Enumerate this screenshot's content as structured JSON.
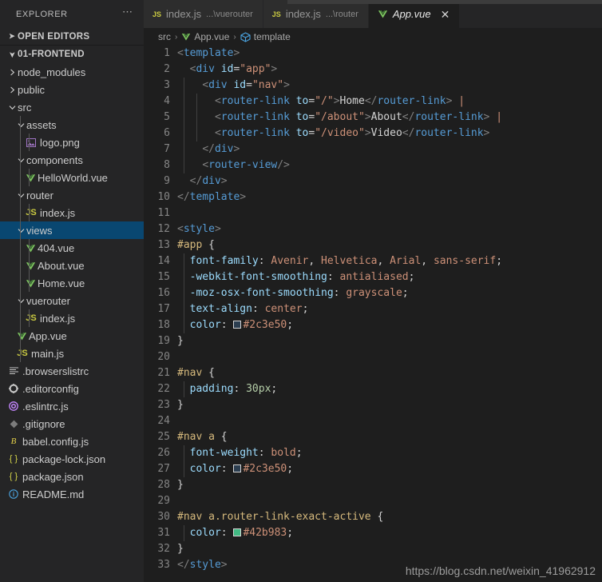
{
  "sidebar": {
    "title": "EXPLORER",
    "more_icon": "ellipsis-icon",
    "open_editors_label": "OPEN EDITORS",
    "project_label": "01-FRONTEND",
    "items": [
      {
        "label": "node_modules",
        "depth": 1,
        "kind": "folder",
        "expanded": false,
        "icon": "chevron-right-icon"
      },
      {
        "label": "public",
        "depth": 1,
        "kind": "folder",
        "expanded": false,
        "icon": "chevron-right-icon"
      },
      {
        "label": "src",
        "depth": 1,
        "kind": "folder",
        "expanded": true,
        "icon": "chevron-down-icon"
      },
      {
        "label": "assets",
        "depth": 2,
        "kind": "folder",
        "expanded": true,
        "icon": "chevron-down-icon"
      },
      {
        "label": "logo.png",
        "depth": 3,
        "kind": "file",
        "icon": "image-icon"
      },
      {
        "label": "components",
        "depth": 2,
        "kind": "folder",
        "expanded": true,
        "icon": "chevron-down-icon"
      },
      {
        "label": "HelloWorld.vue",
        "depth": 3,
        "kind": "file",
        "icon": "vue-icon"
      },
      {
        "label": "router",
        "depth": 2,
        "kind": "folder",
        "expanded": true,
        "icon": "chevron-down-icon"
      },
      {
        "label": "index.js",
        "depth": 3,
        "kind": "file",
        "icon": "js-icon"
      },
      {
        "label": "views",
        "depth": 2,
        "kind": "folder",
        "expanded": true,
        "icon": "chevron-down-icon",
        "selected": true
      },
      {
        "label": "404.vue",
        "depth": 3,
        "kind": "file",
        "icon": "vue-icon"
      },
      {
        "label": "About.vue",
        "depth": 3,
        "kind": "file",
        "icon": "vue-icon"
      },
      {
        "label": "Home.vue",
        "depth": 3,
        "kind": "file",
        "icon": "vue-icon"
      },
      {
        "label": "vuerouter",
        "depth": 2,
        "kind": "folder",
        "expanded": true,
        "icon": "chevron-down-icon"
      },
      {
        "label": "index.js",
        "depth": 3,
        "kind": "file",
        "icon": "js-icon"
      },
      {
        "label": "App.vue",
        "depth": 2,
        "kind": "file",
        "icon": "vue-icon"
      },
      {
        "label": "main.js",
        "depth": 2,
        "kind": "file",
        "icon": "js-icon"
      },
      {
        "label": ".browserslistrc",
        "depth": 1,
        "kind": "file",
        "icon": "list-icon"
      },
      {
        "label": ".editorconfig",
        "depth": 1,
        "kind": "file",
        "icon": "gear-icon"
      },
      {
        "label": ".eslintrc.js",
        "depth": 1,
        "kind": "file",
        "icon": "eslint-icon"
      },
      {
        "label": ".gitignore",
        "depth": 1,
        "kind": "file",
        "icon": "git-icon"
      },
      {
        "label": "babel.config.js",
        "depth": 1,
        "kind": "file",
        "icon": "babel-icon"
      },
      {
        "label": "package-lock.json",
        "depth": 1,
        "kind": "file",
        "icon": "json-icon"
      },
      {
        "label": "package.json",
        "depth": 1,
        "kind": "file",
        "icon": "json-icon"
      },
      {
        "label": "README.md",
        "depth": 1,
        "kind": "file",
        "icon": "markdown-icon"
      }
    ]
  },
  "tabs": [
    {
      "label": "index.js",
      "desc": "...\\vuerouter",
      "icon": "js-icon",
      "active": false,
      "closable": false
    },
    {
      "label": "index.js",
      "desc": "...\\router",
      "icon": "js-icon",
      "active": false,
      "closable": false
    },
    {
      "label": "App.vue",
      "desc": "",
      "icon": "vue-icon",
      "active": true,
      "closable": true,
      "close_icon": "close-icon"
    }
  ],
  "breadcrumb": {
    "items": [
      {
        "label": "src",
        "icon": ""
      },
      {
        "label": "App.vue",
        "icon": "vue-icon"
      },
      {
        "label": "template",
        "icon": "symbol-cube-icon"
      }
    ],
    "separator": "›"
  },
  "editor": {
    "file": "App.vue",
    "language": "vue",
    "total_lines": 33,
    "lines": [
      {
        "n": 1,
        "indent": 0,
        "tokens": [
          {
            "t": "brk",
            "v": "<"
          },
          {
            "t": "tag",
            "v": "template"
          },
          {
            "t": "brk",
            "v": ">"
          }
        ]
      },
      {
        "n": 2,
        "indent": 0,
        "tokens": [
          {
            "t": "txt",
            "v": "  "
          },
          {
            "t": "brk",
            "v": "<"
          },
          {
            "t": "tag",
            "v": "div"
          },
          {
            "t": "txt",
            "v": " "
          },
          {
            "t": "attr",
            "v": "id"
          },
          {
            "t": "punc",
            "v": "="
          },
          {
            "t": "str",
            "v": "\"app\""
          },
          {
            "t": "brk",
            "v": ">"
          }
        ]
      },
      {
        "n": 3,
        "indent": 1,
        "tokens": [
          {
            "t": "txt",
            "v": "    "
          },
          {
            "t": "brk",
            "v": "<"
          },
          {
            "t": "tag",
            "v": "div"
          },
          {
            "t": "txt",
            "v": " "
          },
          {
            "t": "attr",
            "v": "id"
          },
          {
            "t": "punc",
            "v": "="
          },
          {
            "t": "str",
            "v": "\"nav\""
          },
          {
            "t": "brk",
            "v": ">"
          }
        ]
      },
      {
        "n": 4,
        "indent": 2,
        "tokens": [
          {
            "t": "txt",
            "v": "      "
          },
          {
            "t": "brk",
            "v": "<"
          },
          {
            "t": "tag",
            "v": "router-link"
          },
          {
            "t": "txt",
            "v": " "
          },
          {
            "t": "attr",
            "v": "to"
          },
          {
            "t": "punc",
            "v": "="
          },
          {
            "t": "str",
            "v": "\"/\""
          },
          {
            "t": "brk",
            "v": ">"
          },
          {
            "t": "txt",
            "v": "Home"
          },
          {
            "t": "brk",
            "v": "</"
          },
          {
            "t": "tag",
            "v": "router-link"
          },
          {
            "t": "brk",
            "v": ">"
          },
          {
            "t": "txt",
            "v": " "
          },
          {
            "t": "pipe",
            "v": "|"
          }
        ]
      },
      {
        "n": 5,
        "indent": 2,
        "tokens": [
          {
            "t": "txt",
            "v": "      "
          },
          {
            "t": "brk",
            "v": "<"
          },
          {
            "t": "tag",
            "v": "router-link"
          },
          {
            "t": "txt",
            "v": " "
          },
          {
            "t": "attr",
            "v": "to"
          },
          {
            "t": "punc",
            "v": "="
          },
          {
            "t": "str",
            "v": "\"/about\""
          },
          {
            "t": "brk",
            "v": ">"
          },
          {
            "t": "txt",
            "v": "About"
          },
          {
            "t": "brk",
            "v": "</"
          },
          {
            "t": "tag",
            "v": "router-link"
          },
          {
            "t": "brk",
            "v": ">"
          },
          {
            "t": "txt",
            "v": " "
          },
          {
            "t": "pipe",
            "v": "|"
          }
        ]
      },
      {
        "n": 6,
        "indent": 2,
        "tokens": [
          {
            "t": "txt",
            "v": "      "
          },
          {
            "t": "brk",
            "v": "<"
          },
          {
            "t": "tag",
            "v": "router-link"
          },
          {
            "t": "txt",
            "v": " "
          },
          {
            "t": "attr",
            "v": "to"
          },
          {
            "t": "punc",
            "v": "="
          },
          {
            "t": "str",
            "v": "\"/video\""
          },
          {
            "t": "brk",
            "v": ">"
          },
          {
            "t": "txt",
            "v": "Video"
          },
          {
            "t": "brk",
            "v": "</"
          },
          {
            "t": "tag",
            "v": "router-link"
          },
          {
            "t": "brk",
            "v": ">"
          }
        ]
      },
      {
        "n": 7,
        "indent": 1,
        "tokens": [
          {
            "t": "txt",
            "v": "    "
          },
          {
            "t": "brk",
            "v": "</"
          },
          {
            "t": "tag",
            "v": "div"
          },
          {
            "t": "brk",
            "v": ">"
          }
        ]
      },
      {
        "n": 8,
        "indent": 1,
        "tokens": [
          {
            "t": "txt",
            "v": "    "
          },
          {
            "t": "brk",
            "v": "<"
          },
          {
            "t": "tag",
            "v": "router-view"
          },
          {
            "t": "brk",
            "v": "/>"
          }
        ]
      },
      {
        "n": 9,
        "indent": 0,
        "tokens": [
          {
            "t": "txt",
            "v": "  "
          },
          {
            "t": "brk",
            "v": "</"
          },
          {
            "t": "tag",
            "v": "div"
          },
          {
            "t": "brk",
            "v": ">"
          }
        ]
      },
      {
        "n": 10,
        "indent": 0,
        "tokens": [
          {
            "t": "brk",
            "v": "</"
          },
          {
            "t": "tag",
            "v": "template"
          },
          {
            "t": "brk",
            "v": ">"
          }
        ]
      },
      {
        "n": 11,
        "indent": 0,
        "tokens": []
      },
      {
        "n": 12,
        "indent": 0,
        "tokens": [
          {
            "t": "brk",
            "v": "<"
          },
          {
            "t": "tag",
            "v": "style"
          },
          {
            "t": "brk",
            "v": ">"
          }
        ]
      },
      {
        "n": 13,
        "indent": 0,
        "tokens": [
          {
            "t": "sel",
            "v": "#app"
          },
          {
            "t": "txt",
            "v": " "
          },
          {
            "t": "punc",
            "v": "{"
          }
        ]
      },
      {
        "n": 14,
        "indent": 1,
        "tokens": [
          {
            "t": "txt",
            "v": "  "
          },
          {
            "t": "prop",
            "v": "font-family"
          },
          {
            "t": "punc",
            "v": ":"
          },
          {
            "t": "txt",
            "v": " "
          },
          {
            "t": "val",
            "v": "Avenir"
          },
          {
            "t": "punc",
            "v": ","
          },
          {
            "t": "txt",
            "v": " "
          },
          {
            "t": "val",
            "v": "Helvetica"
          },
          {
            "t": "punc",
            "v": ","
          },
          {
            "t": "txt",
            "v": " "
          },
          {
            "t": "val",
            "v": "Arial"
          },
          {
            "t": "punc",
            "v": ","
          },
          {
            "t": "txt",
            "v": " "
          },
          {
            "t": "val",
            "v": "sans-serif"
          },
          {
            "t": "punc",
            "v": ";"
          }
        ]
      },
      {
        "n": 15,
        "indent": 1,
        "tokens": [
          {
            "t": "txt",
            "v": "  "
          },
          {
            "t": "prop",
            "v": "-webkit-font-smoothing"
          },
          {
            "t": "punc",
            "v": ":"
          },
          {
            "t": "txt",
            "v": " "
          },
          {
            "t": "val",
            "v": "antialiased"
          },
          {
            "t": "punc",
            "v": ";"
          }
        ]
      },
      {
        "n": 16,
        "indent": 1,
        "tokens": [
          {
            "t": "txt",
            "v": "  "
          },
          {
            "t": "prop",
            "v": "-moz-osx-font-smoothing"
          },
          {
            "t": "punc",
            "v": ":"
          },
          {
            "t": "txt",
            "v": " "
          },
          {
            "t": "val",
            "v": "grayscale"
          },
          {
            "t": "punc",
            "v": ";"
          }
        ]
      },
      {
        "n": 17,
        "indent": 1,
        "tokens": [
          {
            "t": "txt",
            "v": "  "
          },
          {
            "t": "prop",
            "v": "text-align"
          },
          {
            "t": "punc",
            "v": ":"
          },
          {
            "t": "txt",
            "v": " "
          },
          {
            "t": "val",
            "v": "center"
          },
          {
            "t": "punc",
            "v": ";"
          }
        ]
      },
      {
        "n": 18,
        "indent": 1,
        "tokens": [
          {
            "t": "txt",
            "v": "  "
          },
          {
            "t": "prop",
            "v": "color"
          },
          {
            "t": "punc",
            "v": ":"
          },
          {
            "t": "txt",
            "v": " "
          },
          {
            "t": "swatch",
            "v": "#2c3e50"
          },
          {
            "t": "val",
            "v": "#2c3e50"
          },
          {
            "t": "punc",
            "v": ";"
          }
        ]
      },
      {
        "n": 19,
        "indent": 0,
        "tokens": [
          {
            "t": "punc",
            "v": "}"
          }
        ]
      },
      {
        "n": 20,
        "indent": 0,
        "tokens": []
      },
      {
        "n": 21,
        "indent": 0,
        "tokens": [
          {
            "t": "sel",
            "v": "#nav"
          },
          {
            "t": "txt",
            "v": " "
          },
          {
            "t": "punc",
            "v": "{"
          }
        ]
      },
      {
        "n": 22,
        "indent": 1,
        "tokens": [
          {
            "t": "txt",
            "v": "  "
          },
          {
            "t": "prop",
            "v": "padding"
          },
          {
            "t": "punc",
            "v": ":"
          },
          {
            "t": "txt",
            "v": " "
          },
          {
            "t": "num",
            "v": "30px"
          },
          {
            "t": "punc",
            "v": ";"
          }
        ]
      },
      {
        "n": 23,
        "indent": 0,
        "tokens": [
          {
            "t": "punc",
            "v": "}"
          }
        ]
      },
      {
        "n": 24,
        "indent": 0,
        "tokens": []
      },
      {
        "n": 25,
        "indent": 0,
        "tokens": [
          {
            "t": "sel",
            "v": "#nav a"
          },
          {
            "t": "txt",
            "v": " "
          },
          {
            "t": "punc",
            "v": "{"
          }
        ]
      },
      {
        "n": 26,
        "indent": 1,
        "tokens": [
          {
            "t": "txt",
            "v": "  "
          },
          {
            "t": "prop",
            "v": "font-weight"
          },
          {
            "t": "punc",
            "v": ":"
          },
          {
            "t": "txt",
            "v": " "
          },
          {
            "t": "val",
            "v": "bold"
          },
          {
            "t": "punc",
            "v": ";"
          }
        ]
      },
      {
        "n": 27,
        "indent": 1,
        "tokens": [
          {
            "t": "txt",
            "v": "  "
          },
          {
            "t": "prop",
            "v": "color"
          },
          {
            "t": "punc",
            "v": ":"
          },
          {
            "t": "txt",
            "v": " "
          },
          {
            "t": "swatch",
            "v": "#2c3e50"
          },
          {
            "t": "val",
            "v": "#2c3e50"
          },
          {
            "t": "punc",
            "v": ";"
          }
        ]
      },
      {
        "n": 28,
        "indent": 0,
        "tokens": [
          {
            "t": "punc",
            "v": "}"
          }
        ]
      },
      {
        "n": 29,
        "indent": 0,
        "tokens": []
      },
      {
        "n": 30,
        "indent": 0,
        "tokens": [
          {
            "t": "sel",
            "v": "#nav a.router-link-exact-active"
          },
          {
            "t": "txt",
            "v": " "
          },
          {
            "t": "punc",
            "v": "{"
          }
        ]
      },
      {
        "n": 31,
        "indent": 1,
        "tokens": [
          {
            "t": "txt",
            "v": "  "
          },
          {
            "t": "prop",
            "v": "color"
          },
          {
            "t": "punc",
            "v": ":"
          },
          {
            "t": "txt",
            "v": " "
          },
          {
            "t": "swatch",
            "v": "#42b983"
          },
          {
            "t": "val",
            "v": "#42b983"
          },
          {
            "t": "punc",
            "v": ";"
          }
        ]
      },
      {
        "n": 32,
        "indent": 0,
        "tokens": [
          {
            "t": "punc",
            "v": "}"
          }
        ]
      },
      {
        "n": 33,
        "indent": 0,
        "tokens": [
          {
            "t": "brk",
            "v": "</"
          },
          {
            "t": "tag",
            "v": "style"
          },
          {
            "t": "brk",
            "v": ">"
          }
        ]
      }
    ]
  },
  "watermark": "https://blog.csdn.net/weixin_41962912",
  "colors": {
    "sidebar_bg": "#252526",
    "editor_bg": "#1e1e1e",
    "tab_active_bg": "#1e1e1e",
    "tab_inactive_bg": "#2d2d2d",
    "selection_blue": "#094771",
    "swatch_navy": "#2c3e50",
    "swatch_green": "#42b983",
    "vue_green": "#7ec860"
  }
}
